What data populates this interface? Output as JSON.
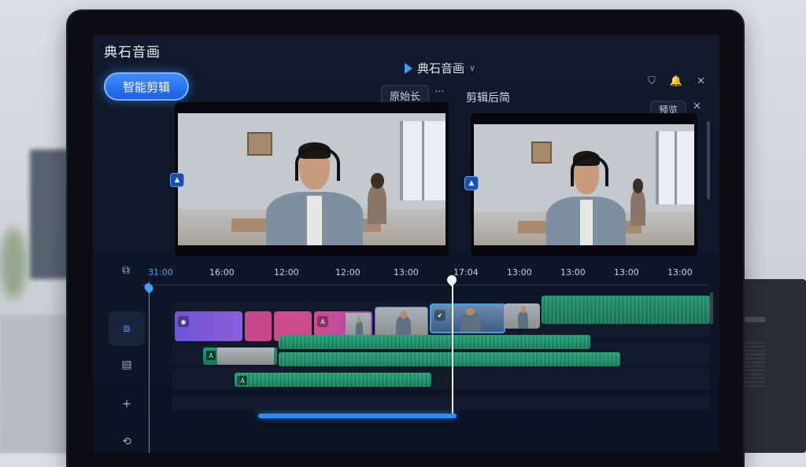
{
  "app": {
    "title": "典石音画"
  },
  "titlebar": {
    "center_title": "典石音画",
    "chevron": "∨"
  },
  "window_controls": {
    "shield": "⛉",
    "bell": "🔔",
    "close": "✕"
  },
  "toolbar": {
    "smart_edit_label": "智能剪辑",
    "original_length_label": "原始长",
    "more_label": "···",
    "after_edit_label": "剪辑后简",
    "right_pill_label": "预览",
    "close_label": "✕"
  },
  "timeline": {
    "ticks": [
      "31:00",
      "16:00",
      "12:00",
      "12:00",
      "13:00",
      "17:04",
      "13:00",
      "13:00",
      "13:00",
      "13:00"
    ]
  },
  "rail": {
    "icons": [
      "layers-icon",
      "text-icon",
      "add-icon",
      "refresh-icon"
    ]
  },
  "colors": {
    "accent": "#2e8cff",
    "audio": "#1f9a6f",
    "clip_purple": "#7a5bd6",
    "clip_pink": "#d64a8e"
  }
}
